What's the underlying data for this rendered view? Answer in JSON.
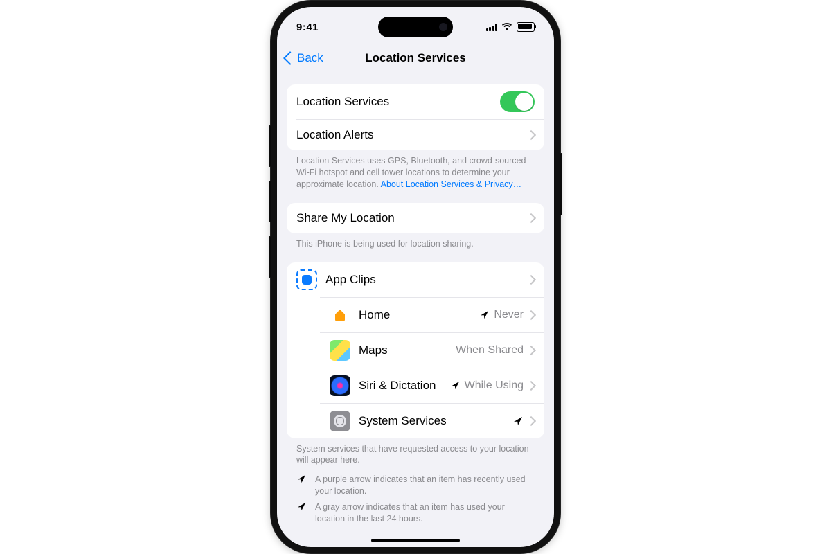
{
  "status": {
    "time": "9:41"
  },
  "nav": {
    "back": "Back",
    "title": "Location Services"
  },
  "group1": {
    "locServices": "Location Services",
    "locAlerts": "Location Alerts"
  },
  "foot1": {
    "text": "Location Services uses GPS, Bluetooth, and crowd-sourced Wi-Fi hotspot and cell tower locations to determine your approximate location. ",
    "link": "About Location Services & Privacy…"
  },
  "group2": {
    "share": "Share My Location"
  },
  "foot2": "This iPhone is being used for location sharing.",
  "apps": [
    {
      "name": "App Clips",
      "detail": "",
      "indicator": ""
    },
    {
      "name": "Home",
      "detail": "Never",
      "indicator": "gray-outline"
    },
    {
      "name": "Maps",
      "detail": "When Shared",
      "indicator": ""
    },
    {
      "name": "Siri & Dictation",
      "detail": "While Using",
      "indicator": "gray-outline"
    },
    {
      "name": "System Services",
      "detail": "",
      "indicator": "purple"
    }
  ],
  "foot3": "System services that have requested access to your location will appear here.",
  "legend": {
    "purple": "A purple arrow indicates that an item has recently used your location.",
    "gray": "A gray arrow indicates that an item has used your location in the last 24 hours."
  }
}
